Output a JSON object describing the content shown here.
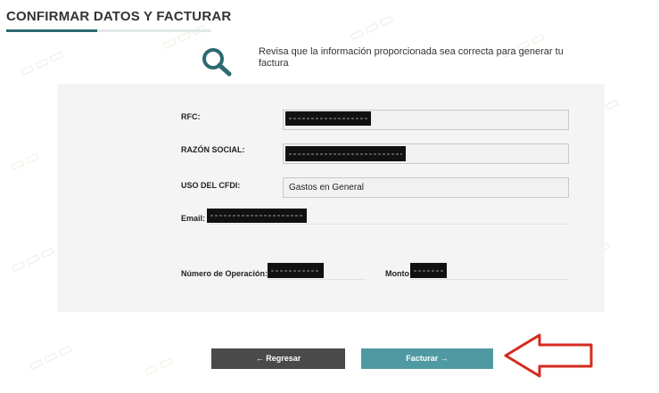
{
  "page": {
    "title": "CONFIRMAR DATOS Y FACTURAR",
    "intro": "Revisa que la información proporcionada sea correcta para generar tu factura"
  },
  "form": {
    "rfc_label": "RFC:",
    "razon_label": "RAZÓN SOCIAL:",
    "uso_label": "USO DEL CFDI:",
    "uso_value": "Gastos en General",
    "email_label": "Email:",
    "operacion_label": "Número de Operación:",
    "monto_label": "Monto"
  },
  "buttons": {
    "back_label": "← Regresar",
    "submit_label": "Facturar →"
  },
  "colors": {
    "accent": "#2c6a70",
    "submit_button": "#4f9aa2",
    "back_button": "#4a4a4a",
    "arrow": "#d42b1e"
  },
  "icons": [
    "search-icon",
    "arrow-left-icon",
    "arrow-right-icon",
    "callout-arrow-icon"
  ]
}
